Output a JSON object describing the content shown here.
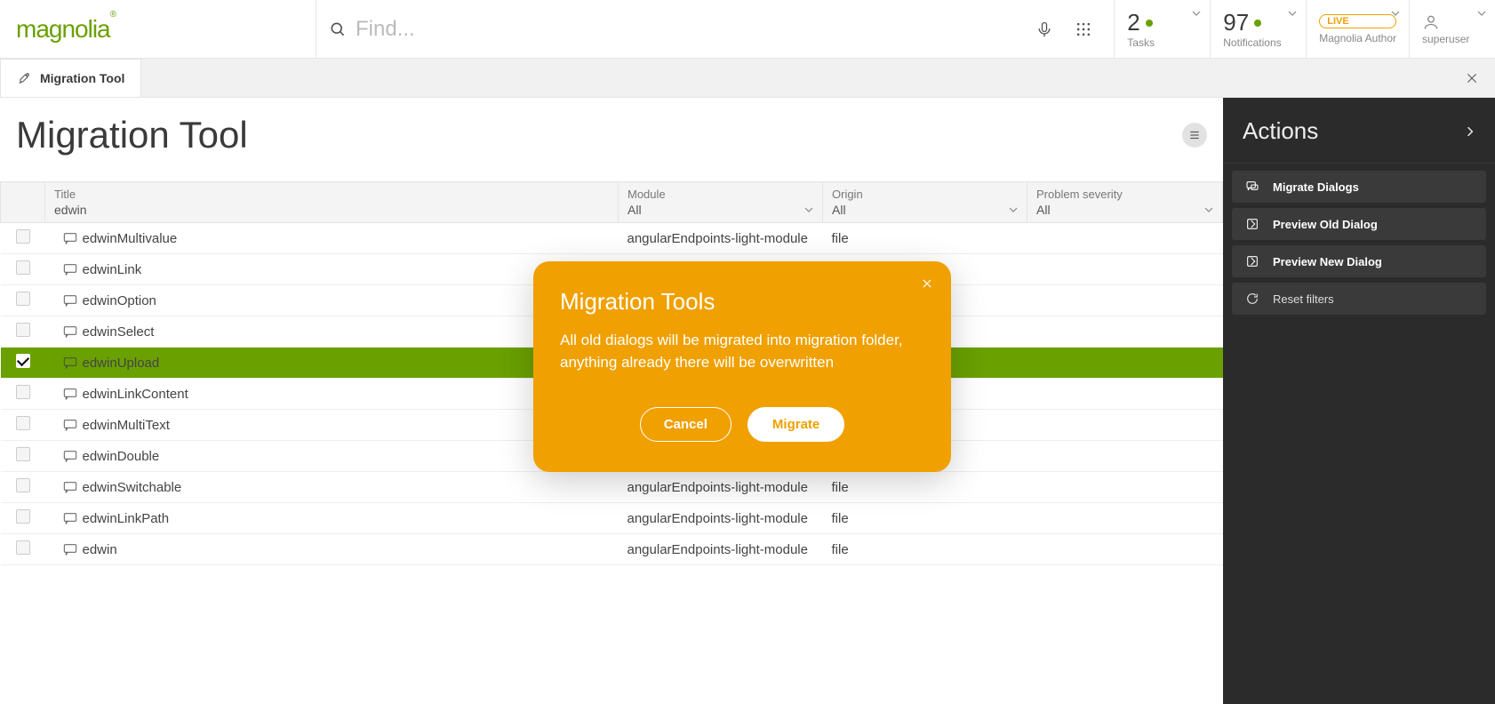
{
  "header": {
    "logo": "magnolia",
    "search_placeholder": "Find...",
    "tasks": {
      "count": "2",
      "label": "Tasks"
    },
    "notifications": {
      "count": "97",
      "label": "Notifications"
    },
    "instance": {
      "badge": "LIVE",
      "label": "Magnolia Author"
    },
    "user": {
      "label": "superuser"
    }
  },
  "tab": {
    "label": "Migration Tool"
  },
  "page": {
    "title": "Migration Tool"
  },
  "table": {
    "columns": {
      "title": {
        "label": "Title",
        "filter": "edwin"
      },
      "module": {
        "label": "Module",
        "filter": "All"
      },
      "origin": {
        "label": "Origin",
        "filter": "All"
      },
      "severity": {
        "label": "Problem severity",
        "filter": "All"
      }
    },
    "rows": [
      {
        "title": "edwinMultivalue",
        "module": "angularEndpoints-light-module",
        "origin": "file",
        "severity": "",
        "selected": false
      },
      {
        "title": "edwinLink",
        "module": "",
        "origin": "",
        "severity": "",
        "selected": false
      },
      {
        "title": "edwinOption",
        "module": "",
        "origin": "",
        "severity": "",
        "selected": false
      },
      {
        "title": "edwinSelect",
        "module": "",
        "origin": "",
        "severity": "",
        "selected": false
      },
      {
        "title": "edwinUpload",
        "module": "",
        "origin": "",
        "severity": "",
        "selected": true
      },
      {
        "title": "edwinLinkContent",
        "module": "",
        "origin": "",
        "severity": "",
        "selected": false
      },
      {
        "title": "edwinMultiText",
        "module": "",
        "origin": "",
        "severity": "",
        "selected": false
      },
      {
        "title": "edwinDouble",
        "module": "angularEndpoints-light-module",
        "origin": "file",
        "severity": "",
        "selected": false
      },
      {
        "title": "edwinSwitchable",
        "module": "angularEndpoints-light-module",
        "origin": "file",
        "severity": "",
        "selected": false
      },
      {
        "title": "edwinLinkPath",
        "module": "angularEndpoints-light-module",
        "origin": "file",
        "severity": "",
        "selected": false
      },
      {
        "title": "edwin",
        "module": "angularEndpoints-light-module",
        "origin": "file",
        "severity": "",
        "selected": false
      }
    ]
  },
  "sidebar": {
    "title": "Actions",
    "actions": [
      {
        "label": "Migrate Dialogs",
        "icon": "chat",
        "emph": true
      },
      {
        "label": "Preview Old Dialog",
        "icon": "preview",
        "emph": true
      },
      {
        "label": "Preview New Dialog",
        "icon": "preview",
        "emph": true
      },
      {
        "label": "Reset filters",
        "icon": "refresh",
        "emph": false
      }
    ]
  },
  "modal": {
    "title": "Migration Tools",
    "body": "All old dialogs will be migrated into migration folder, anything already there will be overwritten",
    "cancel": "Cancel",
    "confirm": "Migrate"
  }
}
